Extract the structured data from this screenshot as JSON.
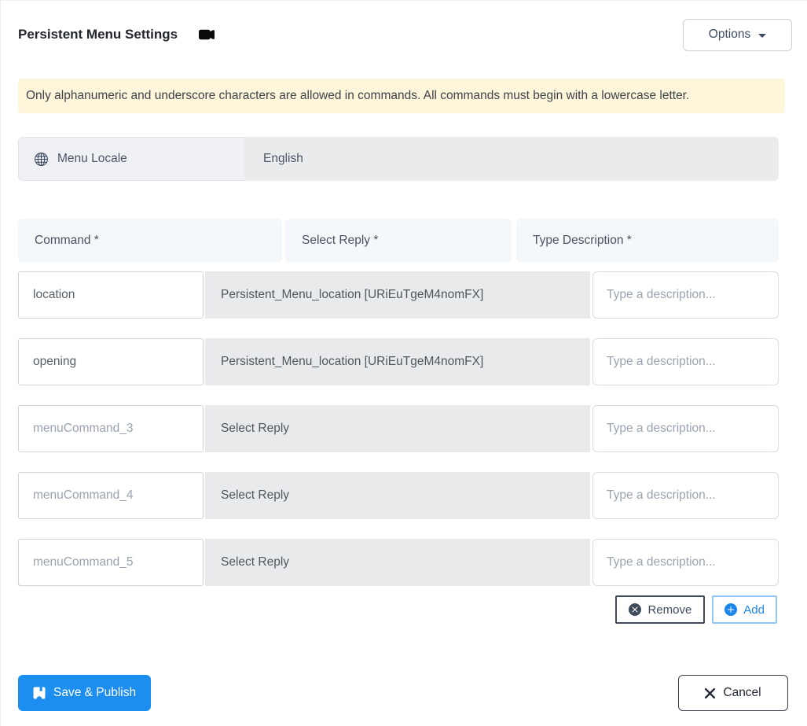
{
  "header": {
    "title": "Persistent Menu Settings",
    "options_button": "Options"
  },
  "alert": {
    "text": "Only alphanumeric and underscore characters are allowed in commands. All commands must begin with a lowercase letter."
  },
  "locale": {
    "label": "Menu Locale",
    "value": "English"
  },
  "table": {
    "headers": [
      "Command *",
      "Select Reply *",
      "Type Description *"
    ],
    "description_placeholder": "Type a description...",
    "rows": [
      {
        "command": "location",
        "command_is_placeholder": false,
        "reply": "Persistent_Menu_location [URiEuTgeM4nomFX]",
        "description": ""
      },
      {
        "command": "opening",
        "command_is_placeholder": false,
        "reply": "Persistent_Menu_location [URiEuTgeM4nomFX]",
        "description": ""
      },
      {
        "command": "menuCommand_3",
        "command_is_placeholder": true,
        "reply": "Select Reply",
        "description": ""
      },
      {
        "command": "menuCommand_4",
        "command_is_placeholder": true,
        "reply": "Select Reply",
        "description": ""
      },
      {
        "command": "menuCommand_5",
        "command_is_placeholder": true,
        "reply": "Select Reply",
        "description": ""
      }
    ]
  },
  "actions": {
    "remove": "Remove",
    "add": "Add"
  },
  "footer": {
    "save": "Save & Publish",
    "cancel": "Cancel"
  },
  "icons": {
    "title": "video-camera-icon",
    "locale": "globe-icon",
    "options": "chevron-down-icon",
    "remove": "x-circle-icon",
    "add": "plus-circle-icon",
    "save": "floppy-disk-icon",
    "cancel": "x-icon"
  },
  "colors": {
    "primary_blue": "#1b8ef0",
    "add_border_blue": "#92c5f8",
    "alert_bg": "#fdf6da",
    "dark_slate": "#3e4a5a",
    "field_gray": "#e9eaec",
    "header_bg": "#f5f8fb"
  }
}
